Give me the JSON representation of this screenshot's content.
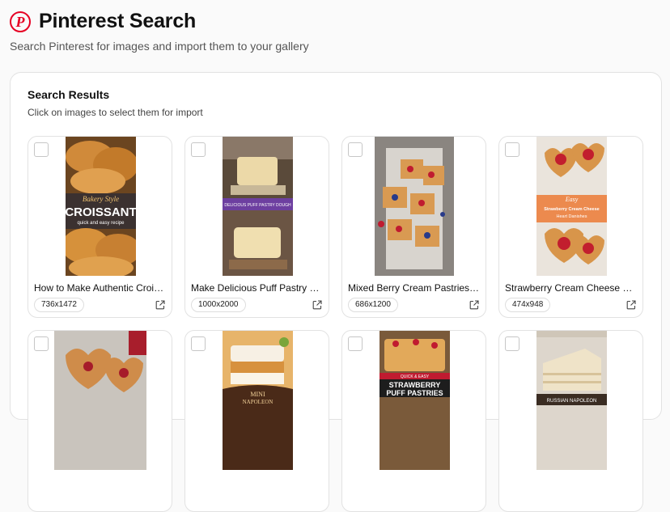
{
  "header": {
    "logo_letter": "P",
    "title": "Pinterest Search",
    "subtitle": "Search Pinterest for images and import them to your gallery"
  },
  "panel": {
    "title": "Search Results",
    "subtitle": "Click on images to select them for import"
  },
  "cards": [
    {
      "title": "How to Make Authentic Croissants",
      "dims": "736x1472",
      "image_text": [
        "Bakery Style",
        "CROISSANT",
        "quick and easy recipe"
      ]
    },
    {
      "title": "Make Delicious Puff Pastry Dough",
      "dims": "1000x2000",
      "image_text": [
        "DELICIOUS PUFF PASTRY DOUGH"
      ]
    },
    {
      "title": "Mixed Berry Cream Pastries🍓✨",
      "dims": "686x1200",
      "image_text": []
    },
    {
      "title": "Strawberry Cream Cheese Heart Danishes",
      "dims": "474x948",
      "image_text": [
        "Easy",
        "Strawberry Cream Cheese",
        "Heart Danishes"
      ]
    },
    {
      "title": "",
      "dims": "",
      "image_text": []
    },
    {
      "title": "",
      "dims": "",
      "image_text": [
        "MINI",
        "NAPOLEON"
      ]
    },
    {
      "title": "",
      "dims": "",
      "image_text": [
        "QUICK & EASY",
        "STRAWBERRY",
        "PUFF PASTRIES"
      ]
    },
    {
      "title": "",
      "dims": "",
      "image_text": [
        "RUSSIAN NAPOLEON"
      ]
    }
  ],
  "icons": {
    "logo": "pinterest-logo-icon",
    "external": "external-link-icon",
    "checkbox": "checkbox-icon"
  },
  "colors": {
    "brand": "#e60023"
  }
}
